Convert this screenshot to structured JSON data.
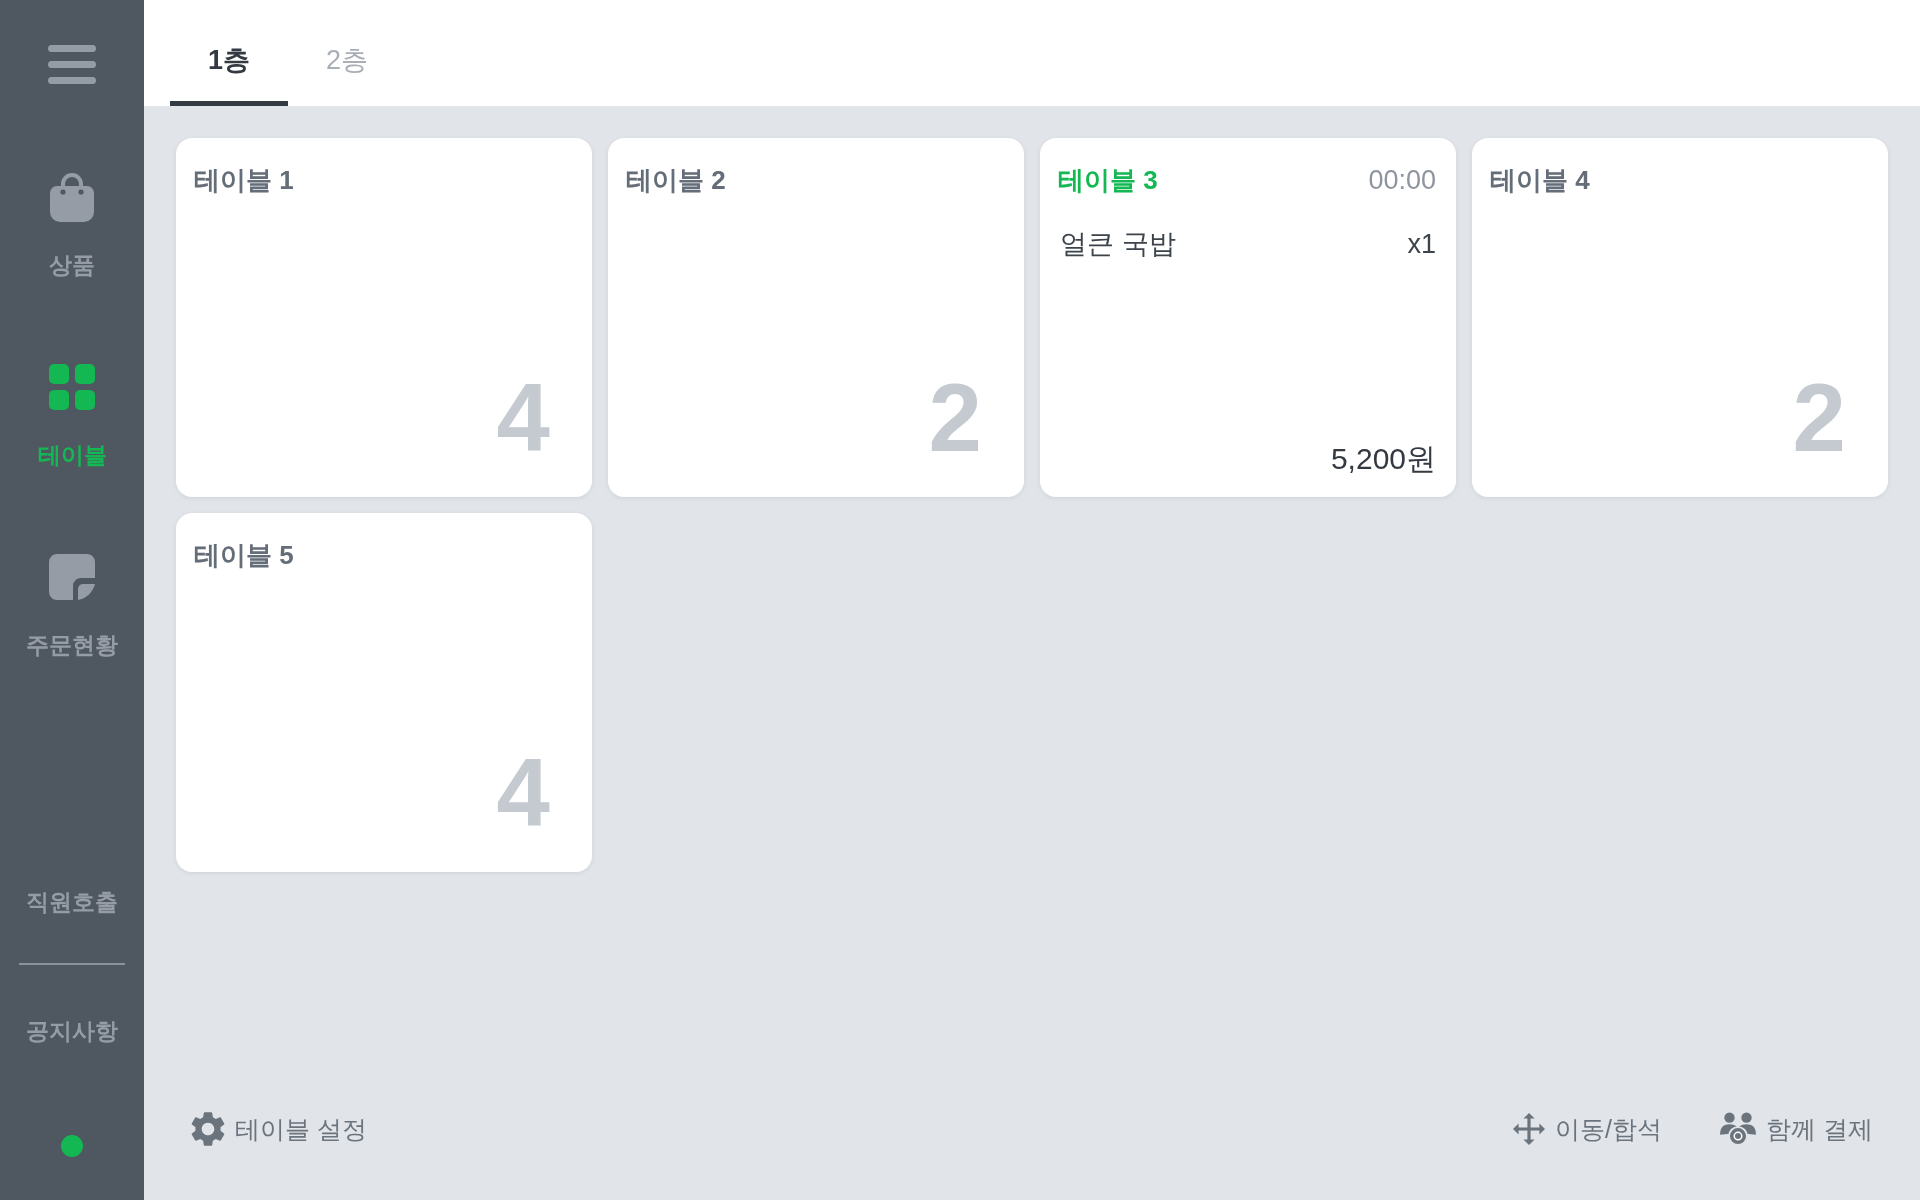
{
  "sidebar": {
    "items": [
      {
        "label": "상품",
        "selected": false
      },
      {
        "label": "테이블",
        "selected": true
      },
      {
        "label": "주문현황",
        "selected": false
      }
    ],
    "links": [
      "직원호출",
      "공지사항"
    ]
  },
  "tabs": [
    {
      "label": "1층",
      "selected": true
    },
    {
      "label": "2층",
      "selected": false
    }
  ],
  "tables": [
    {
      "name": "테이블 1",
      "occupied": false,
      "seats": "4"
    },
    {
      "name": "테이블 2",
      "occupied": false,
      "seats": "2"
    },
    {
      "name": "테이블 3",
      "occupied": true,
      "time": "00:00",
      "orders": [
        {
          "name": "얼큰 국밥",
          "quantity": "x1"
        }
      ],
      "total": "5,200원"
    },
    {
      "name": "테이블 4",
      "occupied": false,
      "seats": "2"
    },
    {
      "name": "테이블 5",
      "occupied": false,
      "seats": "4"
    }
  ],
  "footer": {
    "settings_button": "테이블 설정",
    "actions": [
      "이동/합석",
      "함께 결제"
    ]
  }
}
